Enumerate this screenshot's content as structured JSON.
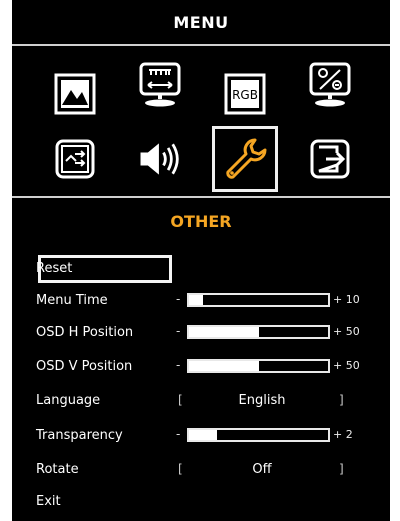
{
  "menu": {
    "title": "MENU",
    "icons": [
      {
        "name": "picture-icon"
      },
      {
        "name": "display-position-icon"
      },
      {
        "name": "rgb-color-icon",
        "text": "RGB"
      },
      {
        "name": "ratio-icon"
      },
      {
        "name": "input-source-icon"
      },
      {
        "name": "audio-icon"
      },
      {
        "name": "wrench-other-icon",
        "selected": true,
        "accent": "#f5a623"
      },
      {
        "name": "exit-icon"
      }
    ]
  },
  "section": {
    "title": "OTHER",
    "title_color": "#f5a623"
  },
  "items": {
    "reset": {
      "label": "Reset"
    },
    "menu_time": {
      "label": "Menu Time",
      "minus": "-",
      "value_text": "+ 10",
      "level": 0.1
    },
    "osd_h": {
      "label": "OSD H Position",
      "minus": "-",
      "value_text": "+ 50",
      "level": 0.5
    },
    "osd_v": {
      "label": "OSD V Position",
      "minus": "-",
      "value_text": "+ 50",
      "level": 0.5
    },
    "language": {
      "label": "Language",
      "left_bracket": "[",
      "value": "English",
      "right_bracket": "]"
    },
    "transparency": {
      "label": "Transparency",
      "minus": "-",
      "value_text": "+ 2",
      "level": 0.2
    },
    "rotate": {
      "label": "Rotate",
      "left_bracket": "[",
      "value": "Off",
      "right_bracket": "]"
    },
    "exit": {
      "label": "Exit"
    }
  }
}
